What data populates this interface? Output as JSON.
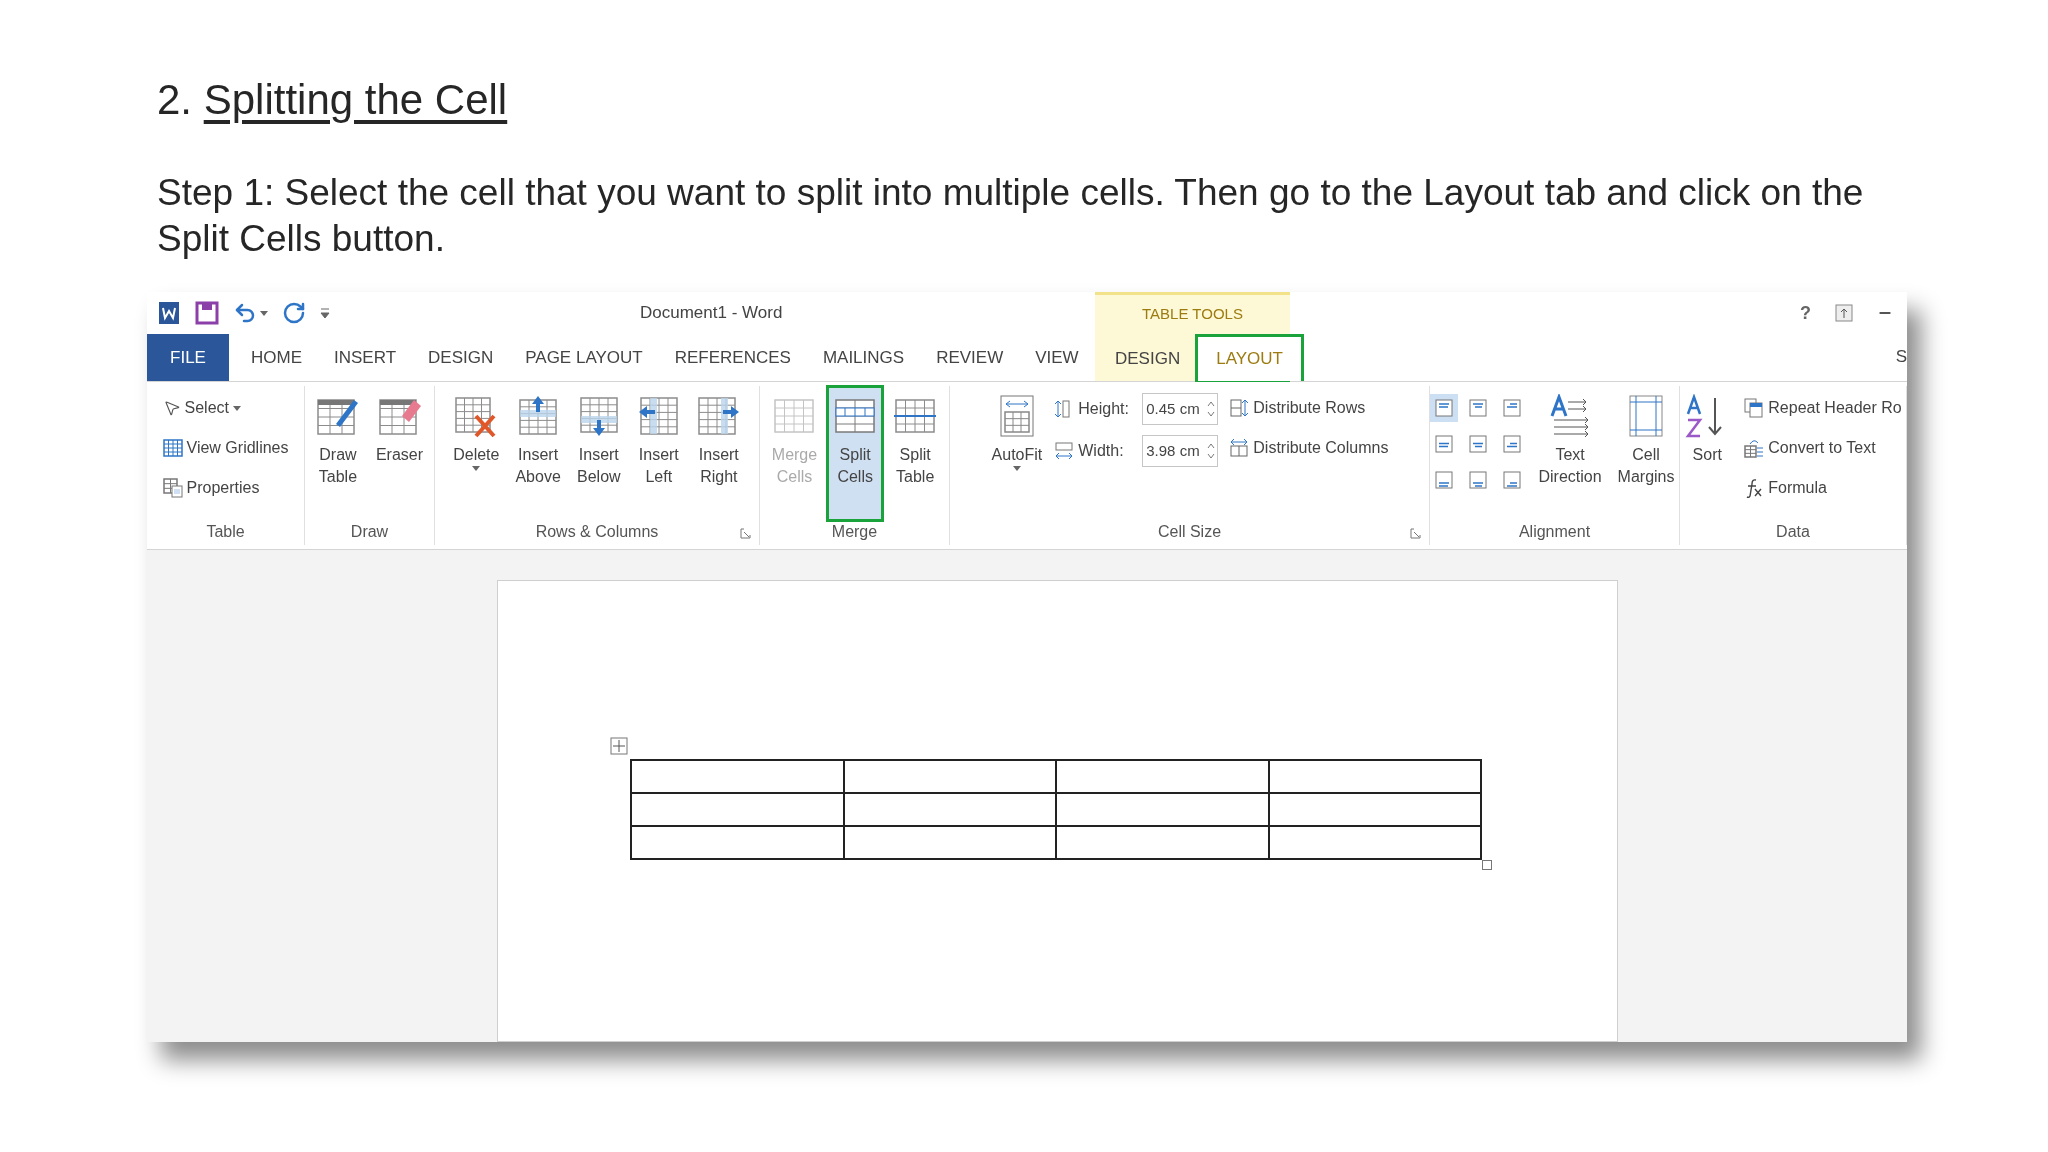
{
  "heading": {
    "number": "2.",
    "title": "Splitting the Cell"
  },
  "instruction": "Step 1: Select the cell that you want to split into multiple cells. Then go to the Layout tab and click on the Split Cells button.",
  "window": {
    "title": "Document1 - Word",
    "help": "?",
    "context": {
      "label": "TABLE TOOLS",
      "tabs": [
        {
          "label": "DESIGN",
          "selected": false,
          "highlighted": false
        },
        {
          "label": "LAYOUT",
          "selected": true,
          "highlighted": true
        }
      ]
    },
    "tabs": [
      {
        "kind": "file",
        "label": "FILE",
        "selected": false
      },
      {
        "kind": "tab",
        "label": "HOME",
        "selected": false
      },
      {
        "kind": "tab",
        "label": "INSERT",
        "selected": false
      },
      {
        "kind": "tab",
        "label": "DESIGN",
        "selected": false
      },
      {
        "kind": "tab",
        "label": "PAGE LAYOUT",
        "selected": false
      },
      {
        "kind": "tab",
        "label": "REFERENCES",
        "selected": false
      },
      {
        "kind": "tab",
        "label": "MAILINGS",
        "selected": false
      },
      {
        "kind": "tab",
        "label": "REVIEW",
        "selected": false
      },
      {
        "kind": "tab",
        "label": "VIEW",
        "selected": false
      }
    ],
    "cut_tab": "S"
  },
  "ribbon": [
    {
      "label": "Table",
      "launcher": false,
      "columns": [
        {
          "items": [
            {
              "kind": "small",
              "label": "Select",
              "dropdown": true
            },
            {
              "kind": "small",
              "label": "View Gridlines",
              "dropdown": false
            },
            {
              "kind": "small",
              "label": "Properties",
              "dropdown": false
            }
          ]
        }
      ]
    },
    {
      "label": "Draw",
      "launcher": false,
      "columns": [
        {
          "items": [
            {
              "kind": "large",
              "label": "Draw Table",
              "dropdown": false,
              "disabled": false,
              "highlighted": false
            }
          ]
        },
        {
          "items": [
            {
              "kind": "large",
              "label": "Eraser",
              "dropdown": false,
              "disabled": false,
              "highlighted": false
            }
          ]
        }
      ]
    },
    {
      "label": "Rows & Columns",
      "launcher": true,
      "columns": [
        {
          "items": [
            {
              "kind": "large",
              "label": "Delete",
              "dropdown": true,
              "disabled": false,
              "highlighted": false
            }
          ]
        },
        {
          "items": [
            {
              "kind": "large",
              "label": "Insert Above",
              "dropdown": false,
              "disabled": false,
              "highlighted": false
            }
          ]
        },
        {
          "items": [
            {
              "kind": "large",
              "label": "Insert Below",
              "dropdown": false,
              "disabled": false,
              "highlighted": false
            }
          ]
        },
        {
          "items": [
            {
              "kind": "large",
              "label": "Insert Left",
              "dropdown": false,
              "disabled": false,
              "highlighted": false
            }
          ]
        },
        {
          "items": [
            {
              "kind": "large",
              "label": "Insert Right",
              "dropdown": false,
              "disabled": false,
              "highlighted": false
            }
          ]
        }
      ]
    },
    {
      "label": "Merge",
      "launcher": false,
      "columns": [
        {
          "items": [
            {
              "kind": "large",
              "label": "Merge Cells",
              "dropdown": false,
              "disabled": true,
              "highlighted": false
            }
          ]
        },
        {
          "items": [
            {
              "kind": "large",
              "label": "Split Cells",
              "dropdown": false,
              "disabled": false,
              "highlighted": true
            }
          ]
        },
        {
          "items": [
            {
              "kind": "large",
              "label": "Split Table",
              "dropdown": false,
              "disabled": false,
              "highlighted": false
            }
          ]
        }
      ]
    },
    {
      "label": "Cell Size",
      "launcher": true,
      "columns": [
        {
          "items": [
            {
              "kind": "large",
              "label": "AutoFit",
              "dropdown": true,
              "disabled": false,
              "highlighted": false
            }
          ]
        },
        {
          "items": [
            {
              "kind": "field",
              "label": "Height:",
              "value": "0.45 cm"
            },
            {
              "kind": "field",
              "label": "Width:",
              "value": "3.98 cm"
            }
          ]
        },
        {
          "items": [
            {
              "kind": "small",
              "label": "Distribute Rows",
              "dropdown": false
            },
            {
              "kind": "small",
              "label": "Distribute Columns",
              "dropdown": false
            }
          ]
        }
      ]
    },
    {
      "label": "Alignment",
      "launcher": false,
      "columns": [
        {
          "items": [
            {
              "kind": "align_grid",
              "cells": [
                {
                  "selected": true
                },
                {
                  "selected": false
                },
                {
                  "selected": false
                },
                {
                  "selected": false
                },
                {
                  "selected": false
                },
                {
                  "selected": false
                },
                {
                  "selected": false
                },
                {
                  "selected": false
                },
                {
                  "selected": false
                }
              ]
            }
          ]
        },
        {
          "items": [
            {
              "kind": "large",
              "label": "Text Direction",
              "dropdown": false,
              "disabled": false,
              "highlighted": false
            }
          ]
        },
        {
          "items": [
            {
              "kind": "large",
              "label": "Cell Margins",
              "dropdown": false,
              "disabled": false,
              "highlighted": false
            }
          ]
        }
      ]
    },
    {
      "label": "Data",
      "launcher": false,
      "columns": [
        {
          "items": [
            {
              "kind": "large",
              "label": "Sort",
              "dropdown": false,
              "disabled": false,
              "highlighted": false
            }
          ]
        },
        {
          "items": [
            {
              "kind": "small",
              "label": "Repeat Header Ro",
              "dropdown": false
            },
            {
              "kind": "small",
              "label": "Convert to Text",
              "dropdown": false
            },
            {
              "kind": "small",
              "label": "Formula",
              "dropdown": false
            }
          ]
        }
      ]
    }
  ],
  "document_table": {
    "rows": [
      {
        "cells": [
          {
            "kind": "empty"
          },
          {
            "kind": "empty"
          },
          {
            "kind": "empty"
          },
          {
            "kind": "empty"
          }
        ]
      },
      {
        "cells": [
          {
            "kind": "empty"
          },
          {
            "kind": "empty"
          },
          {
            "kind": "empty"
          },
          {
            "kind": "empty"
          }
        ]
      },
      {
        "cells": [
          {
            "kind": "empty"
          },
          {
            "kind": "empty"
          },
          {
            "kind": "empty"
          },
          {
            "kind": "empty"
          }
        ]
      }
    ]
  }
}
